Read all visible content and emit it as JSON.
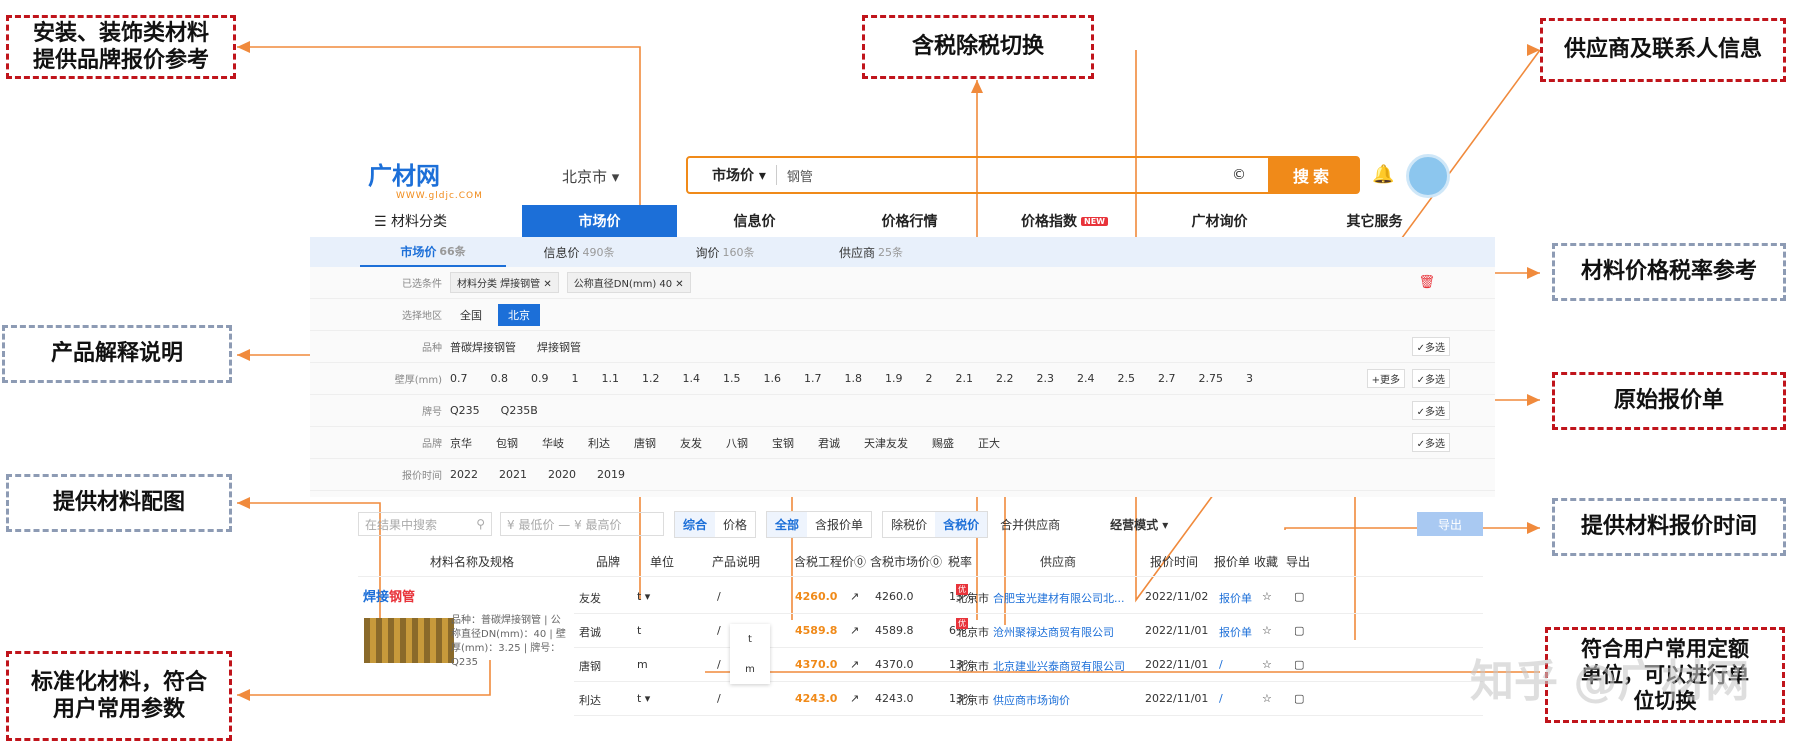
{
  "annotations": {
    "install_brand": "安装、装饰类材料\n提供品牌报价参考",
    "tax_toggle": "含税除税切换",
    "supplier_info": "供应商及联系人信息",
    "tax_rate_ref": "材料价格税率参考",
    "product_explain": "产品解释说明",
    "original_quote": "原始报价单",
    "material_image": "提供材料配图",
    "quote_time": "提供材料报价时间",
    "standardized": "标准化材料，符合\n用户常用参数",
    "unit_switch": "符合用户常用定额\n单位，可以进行单\n位切换"
  },
  "header": {
    "logo_text": "广材网",
    "logo_url": "WWW.gldjc.COM",
    "city": "北京市 ▾",
    "search_category": "市场价 ▾",
    "search_value": "钢管",
    "search_clear": "©",
    "search_button": "搜索",
    "bell_icon": "bell-icon"
  },
  "nav": {
    "category": "☰ 材料分类",
    "items": [
      "市场价",
      "信息价",
      "价格行情",
      "价格指数",
      "广材询价",
      "其它服务"
    ],
    "new_badge": "NEW"
  },
  "tabs": [
    {
      "label": "市场价",
      "count": "66条"
    },
    {
      "label": "信息价",
      "count": "490条"
    },
    {
      "label": "询价",
      "count": "160条"
    },
    {
      "label": "供应商",
      "count": "25条"
    }
  ],
  "filters": {
    "selected_label": "已选条件",
    "selected_chips": [
      "材料分类  焊接钢管 ✕",
      "公称直径DN(mm)  40 ✕"
    ],
    "region_label": "选择地区",
    "regions": [
      "全国",
      "北京"
    ],
    "variety_label": "品种",
    "varieties": [
      "普碳焊接钢管",
      "焊接钢管"
    ],
    "thickness_label": "壁厚(mm)",
    "thickness": [
      "0.7",
      "0.8",
      "0.9",
      "1",
      "1.1",
      "1.2",
      "1.4",
      "1.5",
      "1.6",
      "1.7",
      "1.8",
      "1.9",
      "2",
      "2.1",
      "2.2",
      "2.3",
      "2.4",
      "2.5",
      "2.7",
      "2.75",
      "3"
    ],
    "grade_label": "牌号",
    "grades": [
      "Q235",
      "Q235B"
    ],
    "brand_label": "品牌",
    "brands": [
      "京华",
      "包钢",
      "华岐",
      "利达",
      "唐钢",
      "友发",
      "八钢",
      "宝钢",
      "君诚",
      "天津友发",
      "赐盛",
      "正大"
    ],
    "time_label": "报价时间",
    "years": [
      "2022",
      "2021",
      "2020",
      "2019"
    ],
    "multi": "✓多选",
    "more": "+更多"
  },
  "toolbar": {
    "search_placeholder": "在结果中搜索",
    "price_range": "¥ 最低价  — ¥ 最高价",
    "sort_general": "综合",
    "sort_price": "价格",
    "all": "全部",
    "with_quote": "含报价单",
    "ex_tax": "除税价",
    "inc_tax": "含税价",
    "merge": "合并供应商",
    "mode": "经营模式 ▾",
    "export": "导出"
  },
  "table": {
    "headers": [
      "材料名称及规格",
      "品牌",
      "单位",
      "产品说明",
      "含税工程价⓪",
      "含税市场价⓪",
      "税率",
      "供应商",
      "报价时间",
      "报价单",
      "收藏",
      "导出"
    ],
    "product_title_a": "焊接",
    "product_title_b": "钢管",
    "product_desc": "品种：普碳焊接钢管 | 公称直径DN(mm)：40 | 壁厚(mm)：3.25 | 牌号：Q235",
    "rows": [
      {
        "brand": "友发",
        "unit": "t ▾",
        "desc": "/",
        "eng": "4260.0",
        "mkt": "4260.0",
        "tax": "13%",
        "city": "北京市",
        "supplier": "合肥宝光建材有限公司北...",
        "date": "2022/11/02",
        "quote": "报价单"
      },
      {
        "brand": "君诚",
        "unit": "t",
        "desc": "/",
        "eng": "4589.8",
        "mkt": "4589.8",
        "tax": "6%",
        "city": "北京市",
        "supplier": "沧州聚禄达商贸有限公司",
        "date": "2022/11/01",
        "quote": "报价单"
      },
      {
        "brand": "唐钢",
        "unit": "m",
        "desc": "/",
        "eng": "4370.0",
        "mkt": "4370.0",
        "tax": "13%",
        "city": "北京市",
        "supplier": "北京建业兴泰商贸有限公司",
        "date": "2022/11/01",
        "quote": "/"
      },
      {
        "brand": "利达",
        "unit": "t ▾",
        "desc": "/",
        "eng": "4243.0",
        "mkt": "4243.0",
        "tax": "13%",
        "city": "北京市",
        "supplier": "供应商市场询价",
        "date": "2022/11/01",
        "quote": "/"
      }
    ],
    "dropdown": [
      "t",
      "m"
    ],
    "you_badge": "优"
  },
  "watermark": "知乎 @广材网"
}
